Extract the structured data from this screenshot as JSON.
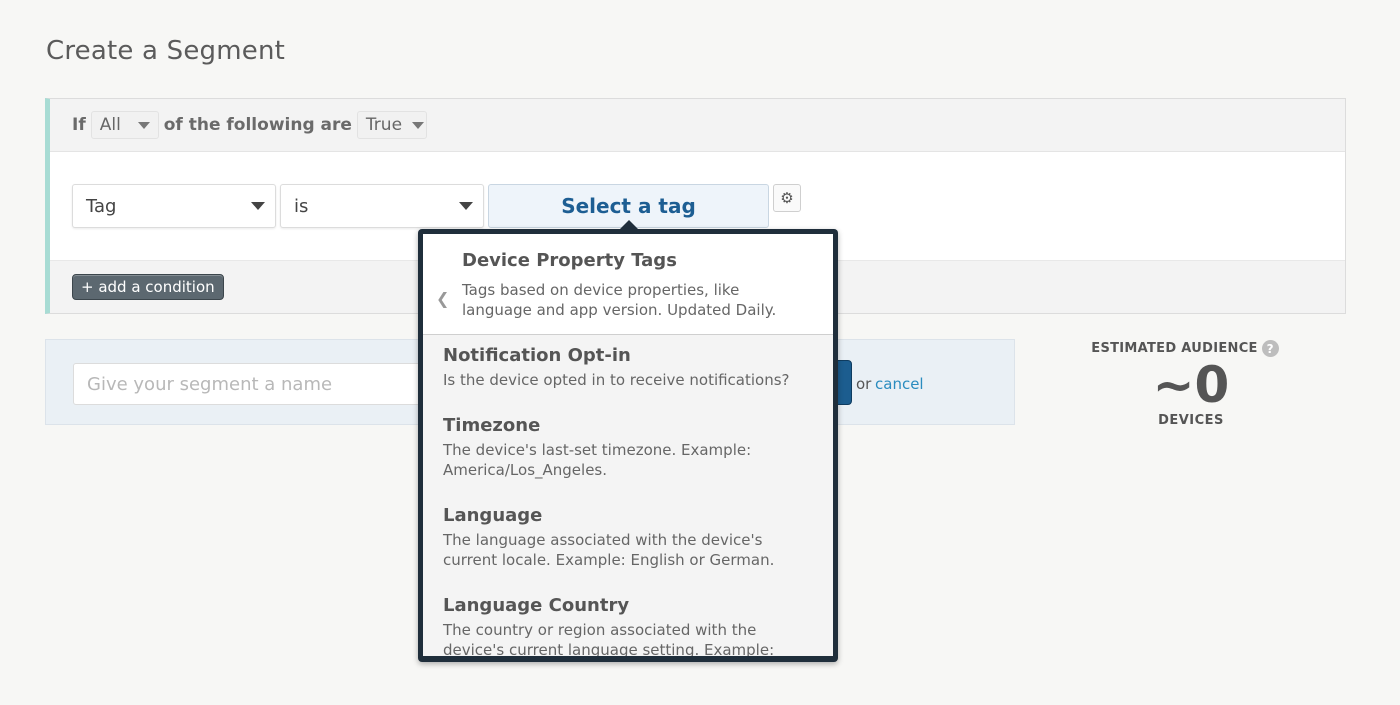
{
  "page": {
    "title": "Create a Segment"
  },
  "criteria": {
    "if_label": "If",
    "match_value": "All",
    "middle_label": "of the following are",
    "truth_value": "True"
  },
  "condition": {
    "field_value": "Tag",
    "operator_value": "is",
    "select_tag_label": "Select a tag",
    "gear_icon": "gear-icon"
  },
  "add_condition_label": "+ add a condition",
  "name_form": {
    "placeholder": "Give your segment a name",
    "or_text": "or",
    "cancel_label": "cancel"
  },
  "audience": {
    "label": "ESTIMATED AUDIENCE",
    "help_glyph": "?",
    "count": "~0",
    "unit": "DEVICES"
  },
  "tag_dropdown": {
    "back_glyph": "❮",
    "header_title": "Device Property Tags",
    "header_desc": "Tags based on device properties, like language and app version. Updated Daily.",
    "items": [
      {
        "title": "Notification Opt-in",
        "desc": "Is the device opted in to receive notifications?"
      },
      {
        "title": "Timezone",
        "desc": "The device's last-set timezone. Example: America/Los_Angeles."
      },
      {
        "title": "Language",
        "desc": "The language associated with the device's current locale. Example: English or German."
      },
      {
        "title": "Language Country",
        "desc": "The country or region associated with the device's current language setting. Example:"
      }
    ]
  }
}
